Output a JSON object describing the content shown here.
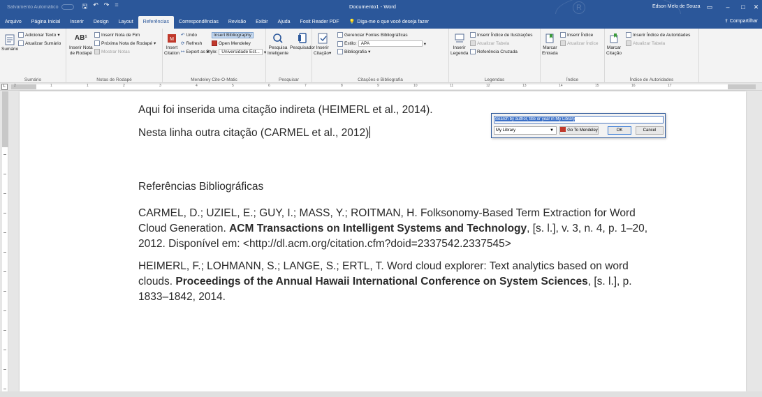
{
  "titlebar": {
    "autosave": "Salvamento Automático",
    "qat": [
      "🖫",
      "↶",
      "↷",
      "="
    ],
    "doc_title": "Documento1 - Word",
    "user": "Edson Melo de Souza",
    "window_buttons": [
      "▭",
      "–",
      "□",
      "✕"
    ]
  },
  "tabs": {
    "items": [
      "Arquivo",
      "Página Inicial",
      "Inserir",
      "Design",
      "Layout",
      "Referências",
      "Correspondências",
      "Revisão",
      "Exibir",
      "Ajuda",
      "Foxit Reader PDF"
    ],
    "active": "Referências",
    "tell_me": "Diga-me o que você deseja fazer",
    "share": "Compartilhar"
  },
  "ribbon": {
    "sumario": {
      "label": "Sumário",
      "sumario_btn": "Sumário",
      "add_text": "Adicionar Texto",
      "update": "Atualizar Sumário"
    },
    "notas": {
      "label": "Notas de Rodapé",
      "insert_end": "Inserir Nota de Fim",
      "next_note": "Próxima Nota de Rodapé",
      "show_notes": "Mostrar Notas",
      "insert_note_l1": "Inserir Nota",
      "insert_note_l2": "de Rodapé",
      "ab": "AB¹"
    },
    "mendeley": {
      "label": "Mendeley Cite-O-Matic",
      "insert_l1": "Insert",
      "insert_l2": "Citation",
      "undo": "Undo",
      "refresh": "Refresh",
      "export": "Export as",
      "insert_bib": "Insert Bibliography",
      "open_mendeley": "Open Mendeley",
      "style_label": "Style:",
      "style_value": "Universidade Est..."
    },
    "pesquisar": {
      "label": "Pesquisar",
      "pesquisa_l1": "Pesquisa",
      "pesquisa_l2": "Inteligente",
      "pesquisador": "Pesquisador"
    },
    "citacoes": {
      "label": "Citações e Bibliografia",
      "insert_l1": "Inserir",
      "insert_l2": "Citação",
      "manage": "Gerenciar Fontes Bibliográficas",
      "style_label": "Estilo:",
      "style_value": "APA",
      "bib": "Bibliografia"
    },
    "legendas": {
      "label": "Legendas",
      "insert_l1": "Inserir",
      "insert_l2": "Legenda",
      "insert_index_ill": "Inserir Índice de Ilustrações",
      "update_table": "Atualizar Tabela",
      "cross_ref": "Referência Cruzada"
    },
    "indice": {
      "label": "Índice",
      "mark_l1": "Marcar",
      "mark_l2": "Entrada",
      "insert_index": "Inserir Índice",
      "update_index": "Atualizar Índice"
    },
    "autoridades": {
      "label": "Índice de Autoridades",
      "mark_l1": "Marcar",
      "mark_l2": "Citação",
      "insert": "Inserir Índice de Autoridades",
      "update": "Atualizar Tabela"
    }
  },
  "ruler": {
    "numbers": [
      "2",
      "1",
      "1",
      "2",
      "3",
      "4",
      "5",
      "6",
      "7",
      "8",
      "9",
      "10",
      "11",
      "12",
      "13",
      "14",
      "15",
      "16",
      "17"
    ]
  },
  "document": {
    "line1": "Aqui foi inserida uma citação indireta (HEIMERL et al., 2014).",
    "line2": "Nesta linha outra citação (CARMEL et al., 2012)",
    "heading": "Referências Bibliográficas",
    "ref1_pre": "CARMEL, D.; UZIEL, E.; GUY, I.; MASS, Y.; ROITMAN, H. Folksonomy-Based Term Extraction for Word Cloud Generation. ",
    "ref1_bold": "ACM Transactions on Intelligent Systems and Technology",
    "ref1_post": ", [s. l.], v. 3, n. 4, p. 1–20, 2012. Disponível em: <http://dl.acm.org/citation.cfm?doid=2337542.2337545>",
    "ref2_pre": "HEIMERL, F.; LOHMANN, S.; LANGE, S.; ERTL, T. Word cloud explorer: Text analytics based on word clouds. ",
    "ref2_bold": "Proceedings of the Annual Hawaii International Conference on System Sciences",
    "ref2_post": ", [s. l.], p. 1833–1842, 2014."
  },
  "dialog": {
    "search_placeholder": "Search by author, title or year in My Library",
    "library": "My Library",
    "goto": "Go To Mendeley",
    "ok": "OK",
    "cancel": "Cancel"
  },
  "colors": {
    "word_blue": "#2b579a",
    "ribbon_bg": "#f3f3f3",
    "mendeley_red": "#c0392b"
  }
}
